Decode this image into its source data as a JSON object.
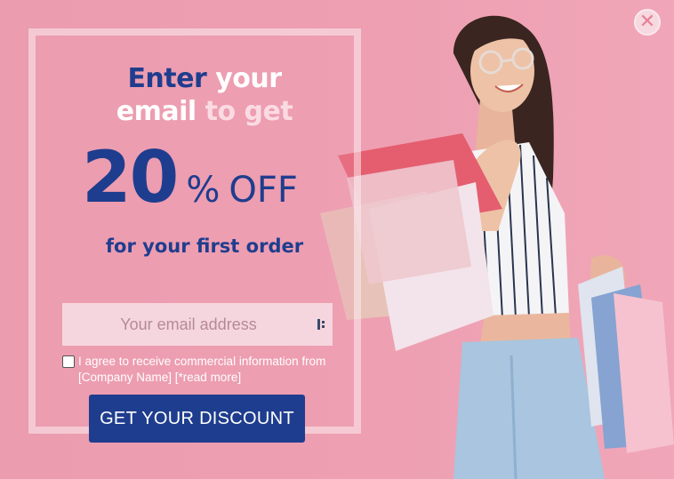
{
  "popup": {
    "headline": {
      "enter": "Enter",
      "your": " your",
      "email": "email",
      "to_get": " to get"
    },
    "discount": {
      "number": "20",
      "percent": "%",
      "off": "OFF"
    },
    "subline": "for your first order",
    "email_input": {
      "placeholder": "Your email address",
      "value": ""
    },
    "consent": {
      "checked": false,
      "text": "I agree to receive commercial information from [Company Name] [*read more]"
    },
    "cta_label": "GET YOUR DISCOUNT",
    "close_icon": "close-icon",
    "field_icon": "password-manager-icon",
    "colors": {
      "background": "#ec9fb0",
      "brand_blue": "#1f3d8e",
      "field_bg": "#f6d6de"
    }
  }
}
